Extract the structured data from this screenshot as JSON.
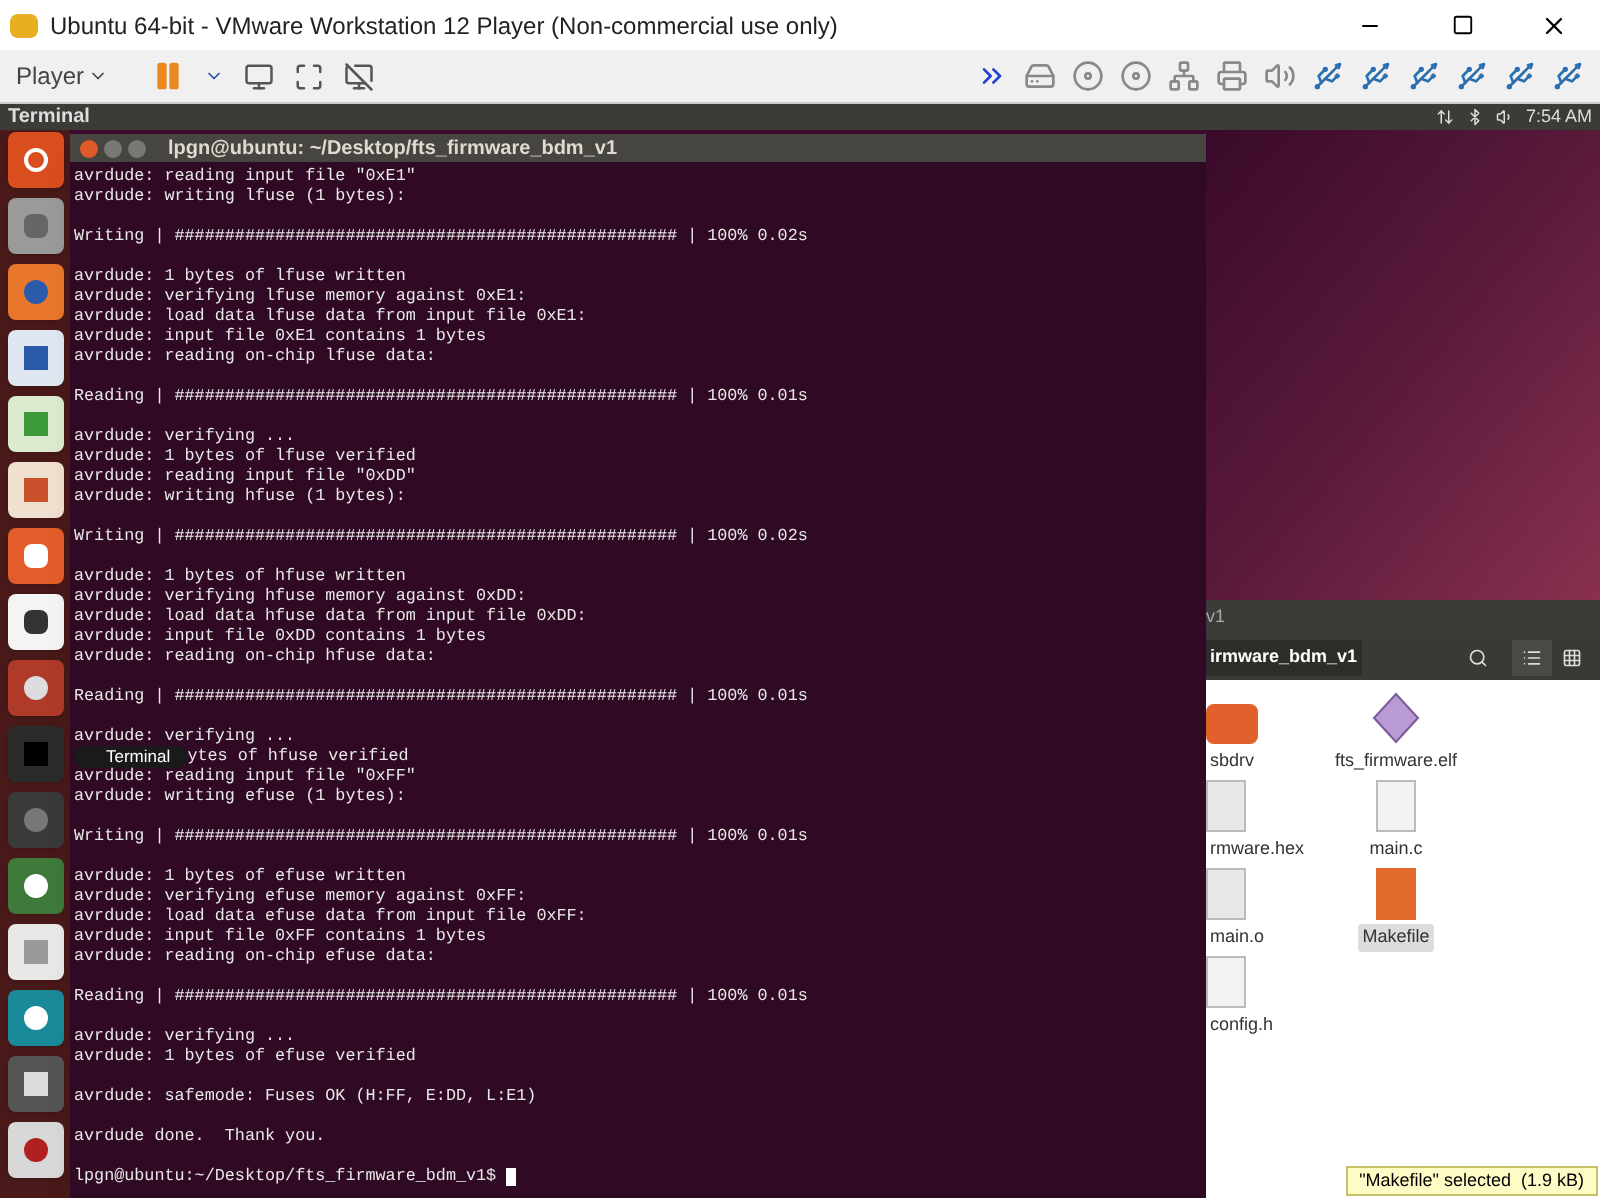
{
  "window": {
    "title": "Ubuntu 64-bit - VMware Workstation 12 Player (Non-commercial use only)"
  },
  "toolbar": {
    "player_menu": "Player"
  },
  "ubuntu_panel": {
    "app_title": "Terminal",
    "clock": "7:54 AM"
  },
  "terminal": {
    "title": "lpgn@ubuntu: ~/Desktop/fts_firmware_bdm_v1",
    "output": [
      {
        "lines": [
          {
            "text": "avrdude: reading input file \"0xE1\""
          },
          {
            "text": "avrdude: writing lfuse (1 bytes):"
          }
        ]
      },
      {
        "lines": [
          {
            "text": "Writing | ################################################## | 100% 0.02s"
          }
        ]
      },
      {
        "lines": [
          {
            "text": "avrdude: 1 bytes of lfuse written"
          },
          {
            "text": "avrdude: verifying lfuse memory against 0xE1:"
          },
          {
            "text": "avrdude: load data lfuse data from input file 0xE1:"
          },
          {
            "text": "avrdude: input file 0xE1 contains 1 bytes"
          },
          {
            "text": "avrdude: reading on-chip lfuse data:"
          }
        ]
      },
      {
        "lines": [
          {
            "text": "Reading | ################################################## | 100% 0.01s"
          }
        ]
      },
      {
        "lines": [
          {
            "text": "avrdude: verifying ..."
          },
          {
            "text": "avrdude: 1 bytes of lfuse verified"
          },
          {
            "text": "avrdude: reading input file \"0xDD\""
          },
          {
            "text": "avrdude: writing hfuse (1 bytes):"
          }
        ]
      },
      {
        "lines": [
          {
            "text": "Writing | ################################################## | 100% 0.02s"
          }
        ]
      },
      {
        "lines": [
          {
            "text": "avrdude: 1 bytes of hfuse written"
          },
          {
            "text": "avrdude: verifying hfuse memory against 0xDD:"
          },
          {
            "text": "avrdude: load data hfuse data from input file 0xDD:"
          },
          {
            "text": "avrdude: input file 0xDD contains 1 bytes"
          },
          {
            "text": "avrdude: reading on-chip hfuse data:"
          }
        ]
      },
      {
        "lines": [
          {
            "text": "Reading | ################################################## | 100% 0.01s"
          }
        ]
      },
      {
        "lines": [
          {
            "text": "avrdude: verifying ..."
          },
          {
            "tooltip": "Terminal",
            "text": "ytes of hfuse verified"
          },
          {
            "text": "avrdude: reading input file \"0xFF\""
          },
          {
            "text": "avrdude: writing efuse (1 bytes):"
          }
        ]
      },
      {
        "lines": [
          {
            "text": "Writing | ################################################## | 100% 0.01s"
          }
        ]
      },
      {
        "lines": [
          {
            "text": "avrdude: 1 bytes of efuse written"
          },
          {
            "text": "avrdude: verifying efuse memory against 0xFF:"
          },
          {
            "text": "avrdude: load data efuse data from input file 0xFF:"
          },
          {
            "text": "avrdude: input file 0xFF contains 1 bytes"
          },
          {
            "text": "avrdude: reading on-chip efuse data:"
          }
        ]
      },
      {
        "lines": [
          {
            "text": "Reading | ################################################## | 100% 0.01s"
          }
        ]
      },
      {
        "lines": [
          {
            "text": "avrdude: verifying ..."
          },
          {
            "text": "avrdude: 1 bytes of efuse verified"
          }
        ]
      },
      {
        "lines": [
          {
            "text": "avrdude: safemode: Fuses OK (H:FF, E:DD, L:E1)"
          }
        ]
      },
      {
        "lines": [
          {
            "text": "avrdude done.  Thank you."
          }
        ]
      }
    ],
    "prompt": "lpgn@ubuntu:~/Desktop/fts_firmware_bdm_v1$"
  },
  "file_manager": {
    "title": "v1",
    "path": "irmware_bdm_v1",
    "files": [
      {
        "name": "sbdrv",
        "kind": "folder",
        "selected": false
      },
      {
        "name": "fts_firmware.elf",
        "kind": "binary",
        "selected": false
      },
      {
        "name": "rmware.hex",
        "kind": "text",
        "selected": false
      },
      {
        "name": "main.c",
        "kind": "source",
        "selected": false
      },
      {
        "name": "main.o",
        "kind": "text",
        "selected": false
      },
      {
        "name": "Makefile",
        "kind": "makefile",
        "selected": true
      },
      {
        "name": "config.h",
        "kind": "source",
        "selected": false
      }
    ],
    "status": "\"Makefile\" selected  (1.9 kB)"
  }
}
